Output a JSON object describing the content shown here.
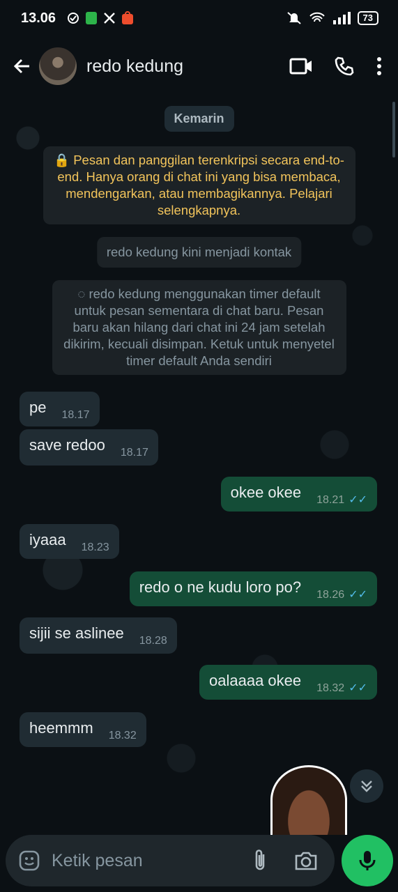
{
  "status_bar": {
    "time": "13.06",
    "battery": "73",
    "icons_left": [
      "check-circle-icon",
      "app-icon",
      "x-icon",
      "shop-icon"
    ],
    "icons_right": [
      "mute-icon",
      "wifi-icon",
      "signal-icon"
    ]
  },
  "header": {
    "back_icon": "arrow-left-icon",
    "contact_name": "redo kedung",
    "actions": [
      "video-call-icon",
      "phone-icon",
      "more-vert-icon"
    ]
  },
  "chat": {
    "date_label": "Kemarin",
    "encryption_notice": "🔒 Pesan dan panggilan terenkripsi secara end-to-end. Hanya orang di chat ini yang bisa membaca, mendengarkan, atau membagikannya. Pelajari selengkapnya.",
    "contact_notice": "redo kedung kini menjadi kontak",
    "timer_notice": "redo kedung menggunakan timer default untuk pesan sementara di chat baru. Pesan baru akan hilang dari chat ini 24 jam setelah dikirim, kecuali disimpan. Ketuk untuk menyetel timer default Anda sendiri",
    "messages": [
      {
        "dir": "in",
        "text": "pe",
        "time": "18.17"
      },
      {
        "dir": "in",
        "text": "save redoo",
        "time": "18.17"
      },
      {
        "dir": "out",
        "text": "okee okee",
        "time": "18.21",
        "ticks": "✓✓"
      },
      {
        "dir": "in",
        "text": "iyaaa",
        "time": "18.23"
      },
      {
        "dir": "out",
        "text": "redo o ne kudu loro po?",
        "time": "18.26",
        "ticks": "✓✓"
      },
      {
        "dir": "in",
        "text": "sijii se aslinee",
        "time": "18.28"
      },
      {
        "dir": "out",
        "text": "oalaaaa okee",
        "time": "18.32",
        "ticks": "✓✓"
      },
      {
        "dir": "in",
        "text": "heemmm",
        "time": "18.32"
      }
    ]
  },
  "composer": {
    "placeholder": "Ketik pesan",
    "icons": [
      "emoji-icon",
      "attach-icon",
      "camera-icon",
      "mic-icon"
    ]
  },
  "colors": {
    "incoming_bubble": "#202c33",
    "outgoing_bubble": "#144d37",
    "accent_green": "#21c063",
    "read_tick": "#53bdeb",
    "notice_text": "#f2c45b"
  }
}
